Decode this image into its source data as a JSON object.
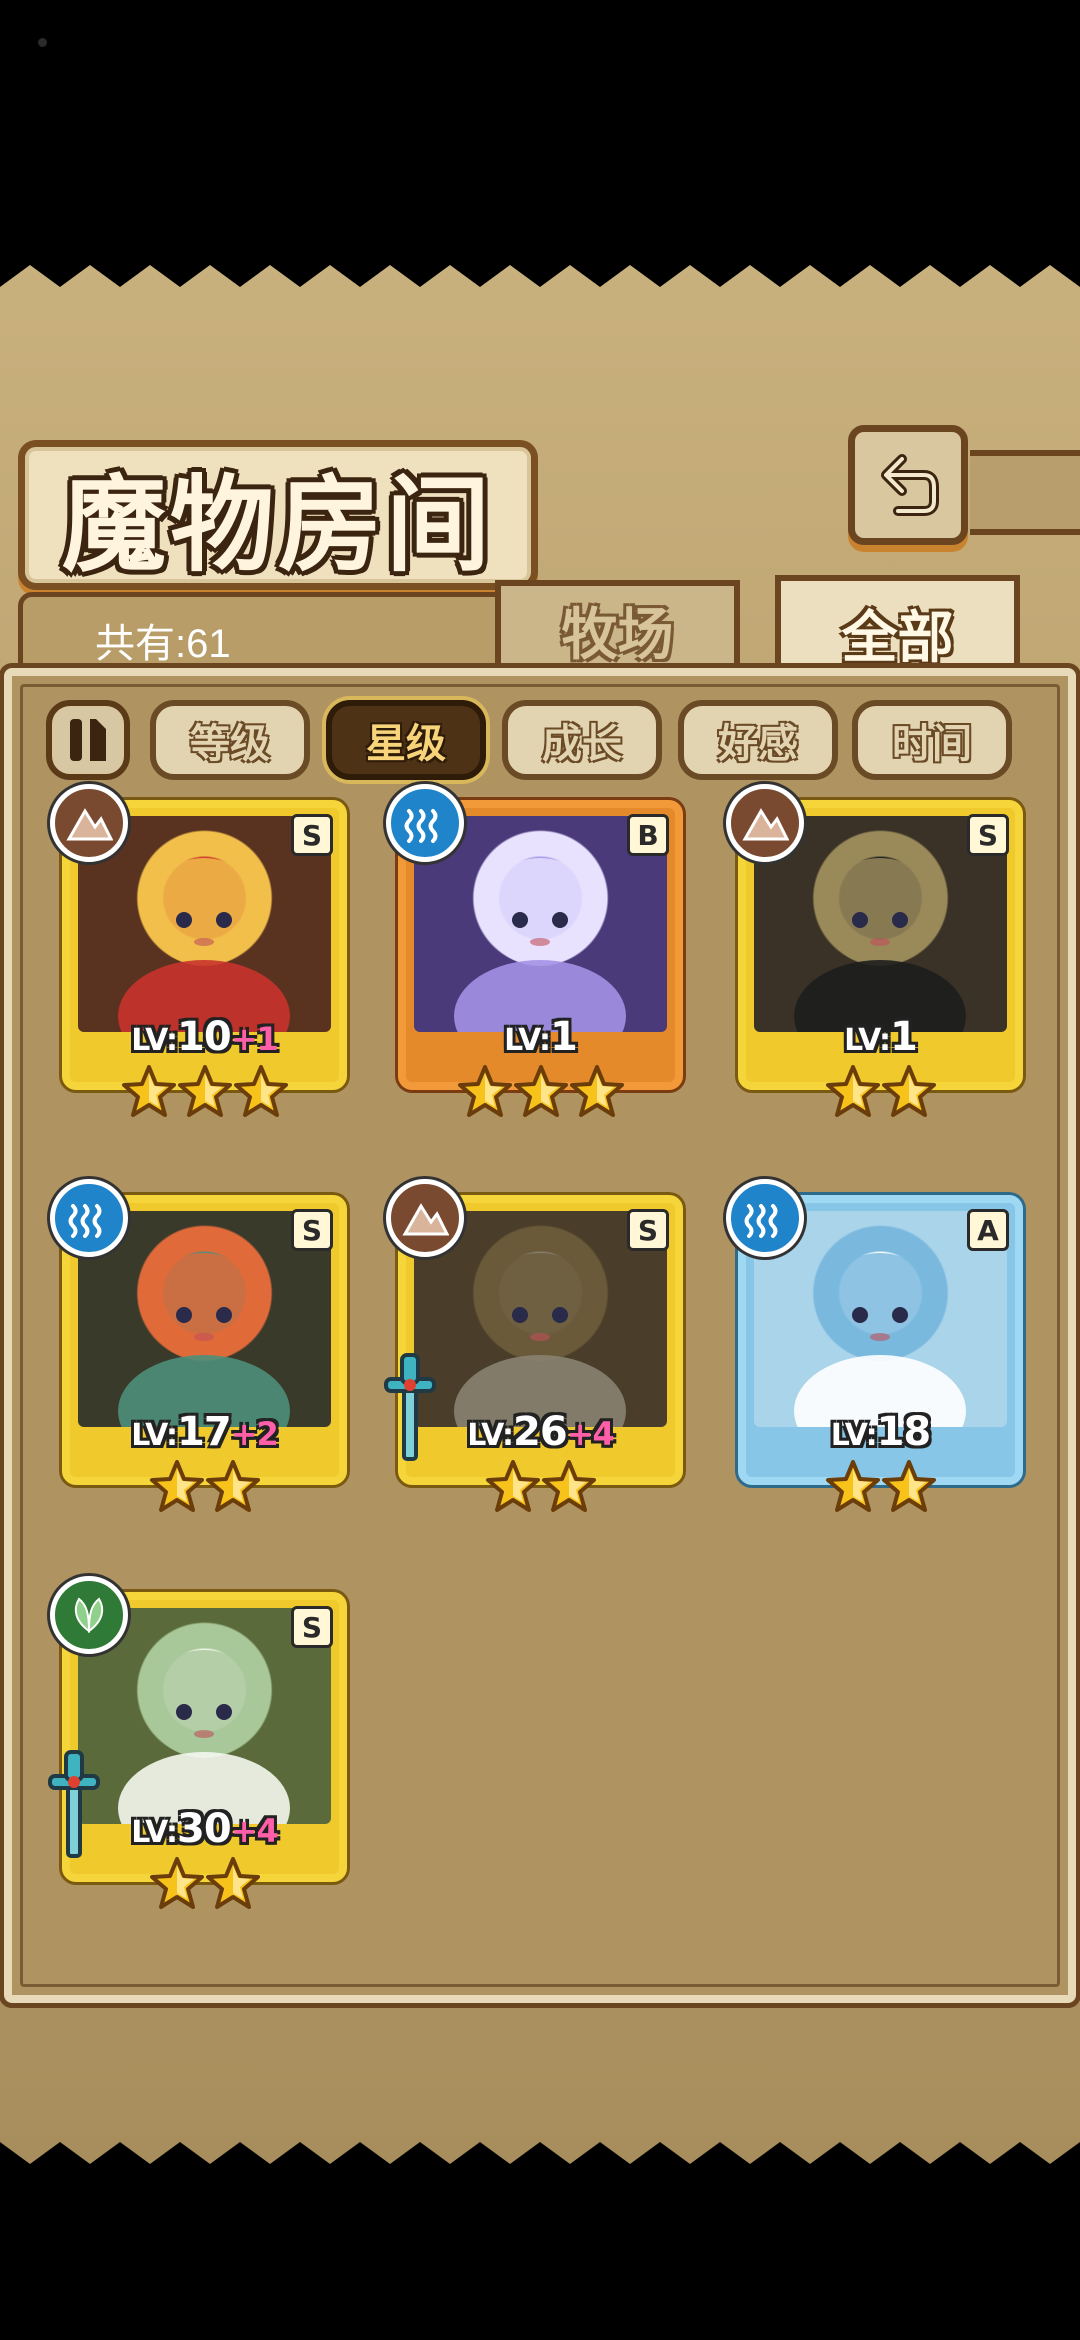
{
  "header": {
    "title": "魔物房间"
  },
  "collection": {
    "count_label": "共有:61"
  },
  "tabs": [
    {
      "label": "牧场",
      "active": false
    },
    {
      "label": "全部",
      "active": true
    }
  ],
  "sort_buttons": [
    {
      "label": "等级",
      "active": false
    },
    {
      "label": "星级",
      "active": true
    },
    {
      "label": "成长",
      "active": false
    },
    {
      "label": "好感",
      "active": false
    },
    {
      "label": "时间",
      "active": false
    }
  ],
  "monsters": [
    {
      "rank": "S",
      "element": "earth",
      "level": "10",
      "bonus": "+1",
      "stars": 3,
      "frame": "gold",
      "weapon": false
    },
    {
      "rank": "B",
      "element": "water",
      "level": "1",
      "bonus": "",
      "stars": 3,
      "frame": "orange",
      "weapon": false
    },
    {
      "rank": "S",
      "element": "earth",
      "level": "1",
      "bonus": "",
      "stars": 2,
      "frame": "gold",
      "weapon": false
    },
    {
      "rank": "S",
      "element": "water",
      "level": "17",
      "bonus": "+2",
      "stars": 2,
      "frame": "gold",
      "weapon": false
    },
    {
      "rank": "S",
      "element": "earth",
      "level": "26",
      "bonus": "+4",
      "stars": 2,
      "frame": "gold",
      "weapon": true
    },
    {
      "rank": "A",
      "element": "water",
      "level": "18",
      "bonus": "",
      "stars": 2,
      "frame": "blue",
      "weapon": false
    },
    {
      "rank": "S",
      "element": "wood",
      "level": "30",
      "bonus": "+4",
      "stars": 2,
      "frame": "gold",
      "weapon": true
    }
  ],
  "labels": {
    "lv_prefix": "LV:"
  },
  "colors": {
    "gold_frame": "#f5d53a",
    "orange_frame": "#f29a3a",
    "blue_frame": "#9fd8f2",
    "bonus": "#ff5fa8",
    "panel": "#af9462"
  }
}
